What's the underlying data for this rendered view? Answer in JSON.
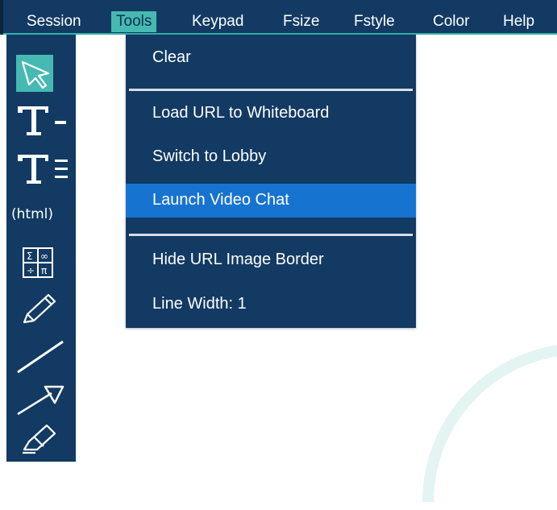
{
  "menubar": {
    "items": [
      {
        "label": "Session",
        "active": false
      },
      {
        "label": "Tools",
        "active": true
      },
      {
        "label": "Keypad",
        "active": false
      },
      {
        "label": "Fsize",
        "active": false
      },
      {
        "label": "Fstyle",
        "active": false
      },
      {
        "label": "Color",
        "active": false
      },
      {
        "label": "Help",
        "active": false
      }
    ]
  },
  "toolbar": {
    "tools": [
      {
        "icon": "select-arrow-icon",
        "selected": true
      },
      {
        "icon": "text-line-icon",
        "selected": false
      },
      {
        "icon": "text-block-icon",
        "selected": false
      },
      {
        "icon": "html-icon",
        "selected": false,
        "label": "(html)"
      },
      {
        "icon": "math-symbols-icon",
        "selected": false
      },
      {
        "icon": "pencil-icon",
        "selected": false
      },
      {
        "icon": "line-icon",
        "selected": false
      },
      {
        "icon": "arrow-icon",
        "selected": false
      },
      {
        "icon": "eraser-icon",
        "selected": false
      }
    ]
  },
  "tools_menu": {
    "items": [
      {
        "label": "Clear",
        "highlight": false
      },
      {
        "label": "Load URL to Whiteboard",
        "highlight": false
      },
      {
        "label": "Switch to Lobby",
        "highlight": false
      },
      {
        "label": "Launch Video Chat",
        "highlight": true
      },
      {
        "label": "Hide URL Image Border",
        "highlight": false
      },
      {
        "label": "Line Width: 1",
        "highlight": false
      }
    ]
  },
  "colors": {
    "menubar_bg": "#123a63",
    "accent": "#46b9b2",
    "highlight": "#1773d0"
  }
}
